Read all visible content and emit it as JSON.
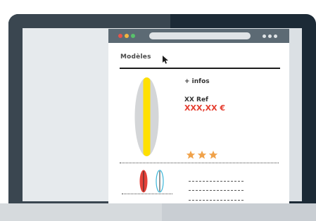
{
  "page": {
    "title": "Modèles"
  },
  "product": {
    "infos_link": "+ infos",
    "reference": "XX Ref",
    "price": "XXX,XX €",
    "rating": 3,
    "rating_max": 3
  },
  "icons": {
    "cursor": "arrow-cursor-icon",
    "star": "star-icon",
    "surfboard": "surfboard-icon"
  },
  "colors": {
    "laptop_frame": "#1c2a36",
    "price": "#e53d2f",
    "star": "#f0a24a",
    "board_main": "#ffe000",
    "board_thumb_red": "#e5413a",
    "board_thumb_blue": "#39b6d9",
    "window_red": "#e9534a",
    "window_yellow": "#f3b53f",
    "window_green": "#58c26b"
  }
}
